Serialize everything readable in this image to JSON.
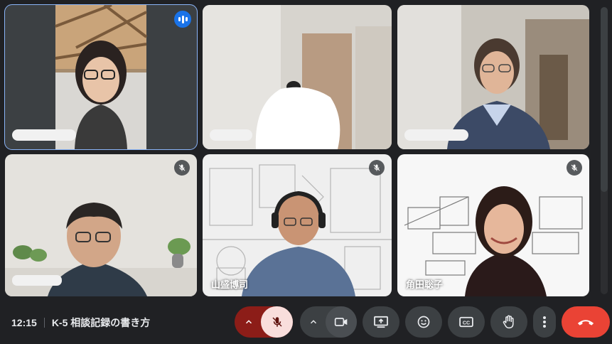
{
  "meeting": {
    "time": "12:15",
    "title": "K-5 相談記録の書き方"
  },
  "participants": [
    {
      "name": "",
      "speaking": true,
      "muted": false
    },
    {
      "name": "",
      "speaking": false,
      "muted": false
    },
    {
      "name": "",
      "speaking": false,
      "muted": false
    },
    {
      "name": "",
      "speaking": false,
      "muted": true
    },
    {
      "name": "山盛博司",
      "speaking": false,
      "muted": true
    },
    {
      "name": "角田聡子",
      "speaking": false,
      "muted": true
    }
  ],
  "colors": {
    "accent": "#8ab4f8",
    "mic_off_bg": "#f9dedc",
    "hangup": "#ea4335",
    "bar": "#202124"
  },
  "controls": [
    "mic-options-chevron",
    "mic-toggle",
    "camera-options-chevron",
    "camera-toggle",
    "present",
    "reactions",
    "captions",
    "raise-hand",
    "more-options",
    "leave-call"
  ]
}
